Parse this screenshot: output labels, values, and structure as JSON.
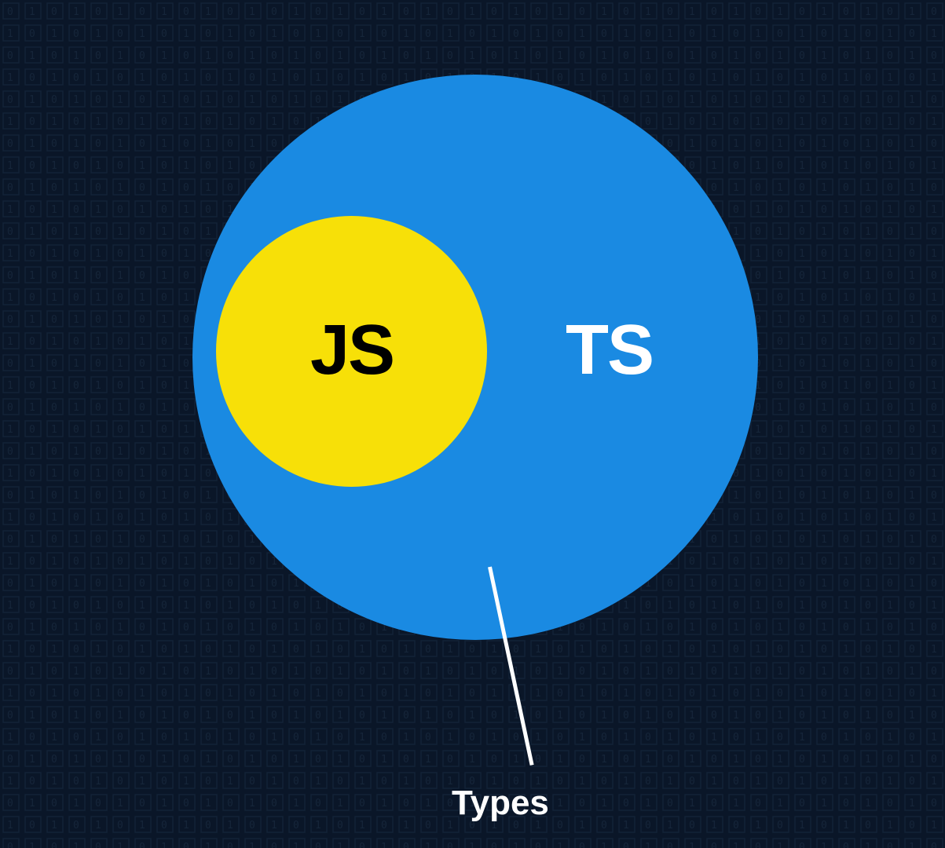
{
  "diagram": {
    "outer_label": "TS",
    "inner_label": "JS",
    "callout_label": "Types",
    "colors": {
      "background": "#0a1628",
      "outer_circle": "#1a8ae2",
      "inner_circle": "#f7e008",
      "js_text": "#000000",
      "ts_text": "#ffffff",
      "callout": "#ffffff"
    }
  }
}
